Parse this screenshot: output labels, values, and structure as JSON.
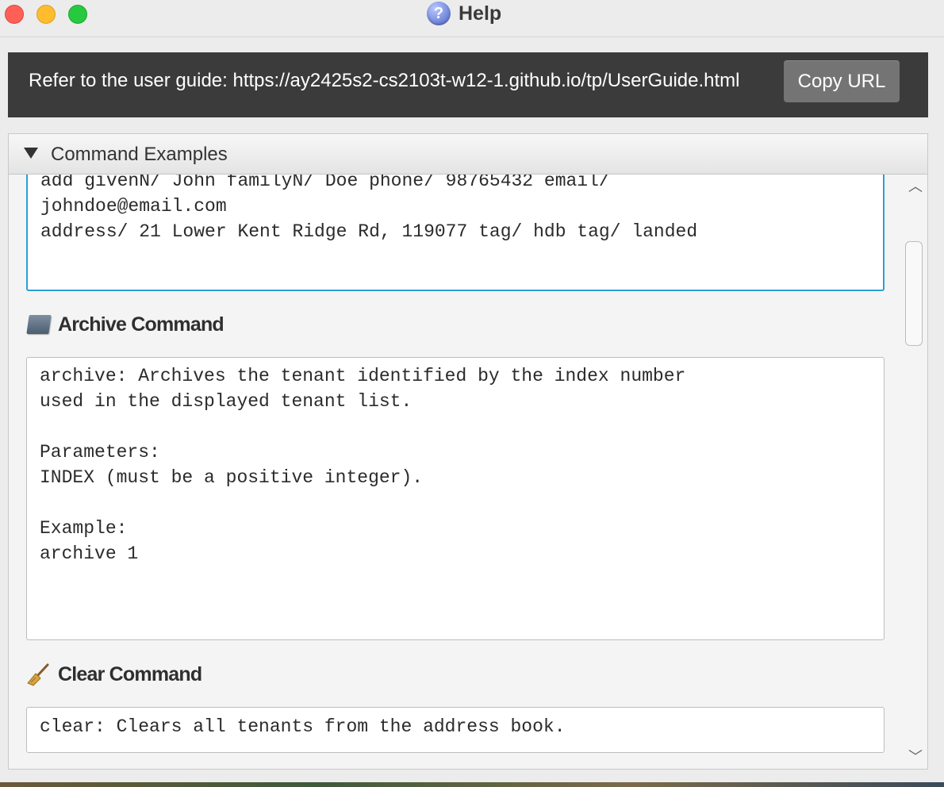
{
  "window": {
    "title": "Help",
    "icon": "question-mark-icon"
  },
  "url_bar": {
    "text": "Refer to the user guide: https://ay2425s2-cs2103t-w12-1.github.io/tp/UserGuide.html",
    "copy_button_label": "Copy URL"
  },
  "pane": {
    "title": "Command Examples",
    "add_box_text": "add givenN/ John familyN/ Doe phone/ 98765432 email/\njohndoe@email.com\naddress/ 21 Lower Kent Ridge Rd, 119077 tag/ hdb tag/ landed",
    "sections": {
      "archive": {
        "icon": "folder-icon",
        "title": "Archive Command",
        "text": "archive: Archives the tenant identified by the index number\nused in the displayed tenant list.\n\nParameters:\nINDEX (must be a positive integer).\n\nExample:\narchive 1"
      },
      "clear": {
        "icon": "broom-icon",
        "title": "Clear Command",
        "text": "clear: Clears all tenants from the address book."
      }
    }
  }
}
